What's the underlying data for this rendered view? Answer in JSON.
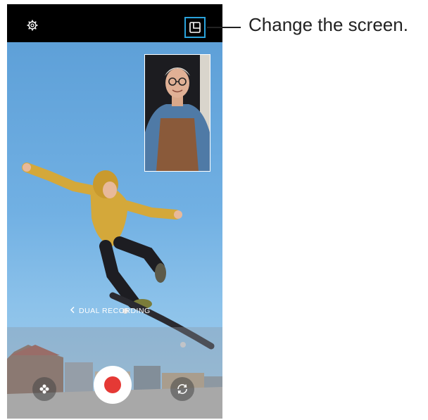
{
  "callout": {
    "text": "Change the screen."
  },
  "camera": {
    "mode_label": "DUAL RECORDING",
    "icons": {
      "settings": "gear-icon",
      "change_screen": "screen-layout-icon",
      "back": "chevron-left-icon",
      "effects": "effects-icon",
      "switch_camera": "switch-camera-icon"
    },
    "colors": {
      "accent": "#2aa3dc",
      "record": "#e53935"
    }
  }
}
